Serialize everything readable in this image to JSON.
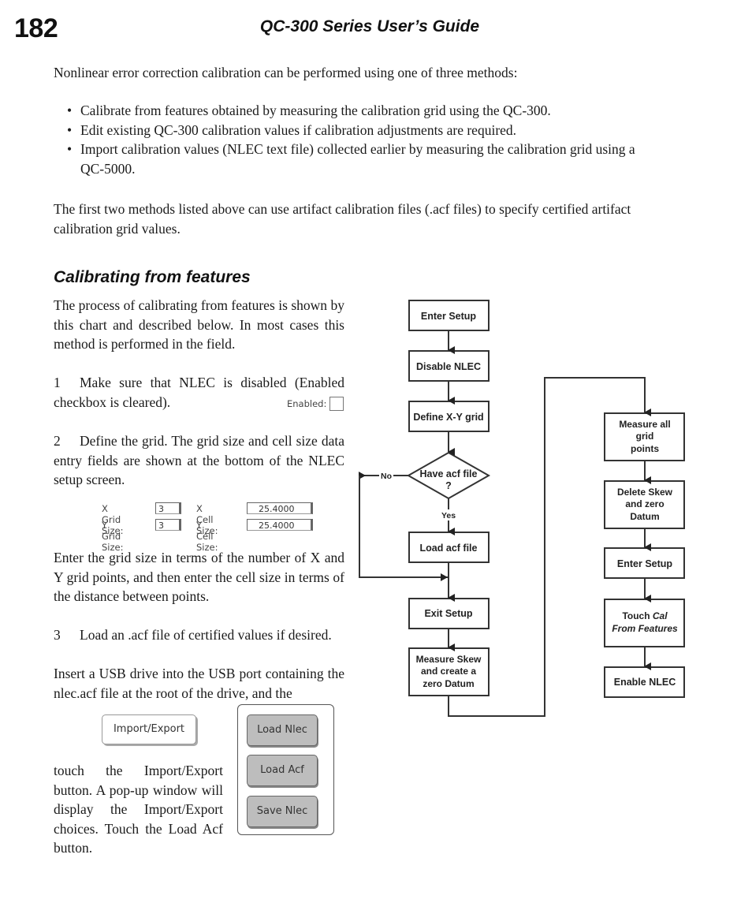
{
  "header": {
    "page_number": "182",
    "title": "QC-300 Series User’s Guide"
  },
  "intro": {
    "lead": "Nonlinear error correction calibration can be performed using one of three methods:",
    "bullets": [
      "Calibrate from features obtained by measuring the calibration grid using the QC-300.",
      "Edit existing QC-300 calibration values if calibration adjustments are required.",
      "Import calibration values (NLEC text file) collected earlier by measuring the calibration grid using a QC-5000."
    ],
    "note": "The first two methods listed above can use artifact calibration files (.acf files) to specify certified artifact calibration grid values."
  },
  "section": {
    "heading": "Calibrating from features",
    "intro": "The process of calibrating from features is shown by this chart and described below. In most cases this method is performed in the field.",
    "steps": [
      {
        "number": "1",
        "text": "Make sure that NLEC is disabled (Enabled checkbox is cleared)."
      },
      {
        "number": "2",
        "text": "Define the grid.  The grid size and cell size data entry fields are shown at the bottom of the NLEC setup screen."
      },
      {
        "number": "3",
        "text": "Load an .acf file of certified values if desired."
      }
    ],
    "grid_note": "Enter the grid size in terms of the number of X and Y grid points, and then enter the cell size in terms of the distance between points.",
    "usb_note": "Insert a USB drive into the USB port containing the nlec.acf file at the root of the drive, and the",
    "touch_note": "touch the Import/Export button.  A pop-up window will display the Import/Export choices.  Touch the Load Acf button."
  },
  "ui_samples": {
    "enabled_label": "Enabled:",
    "enabled_checked": false,
    "x_grid_label": "X Grid Size:",
    "x_grid_value": "3",
    "y_grid_label": "Y Grid Size:",
    "y_grid_value": "3",
    "x_cell_label": "X Cell Size:",
    "x_cell_value": "25.4000",
    "y_cell_label": "Y Cell Size:",
    "y_cell_value": "25.4000",
    "import_export_button": "Import/Export",
    "popup_buttons": [
      "Load Nlec",
      "Load Acf",
      "Save Nlec"
    ]
  },
  "flowchart": {
    "left_column": [
      "Enter Setup",
      "Disable NLEC",
      "Define X-Y grid"
    ],
    "decision": {
      "line1": "Have acf file",
      "line2": "?",
      "no_label": "No",
      "yes_label": "Yes"
    },
    "load_step": "Load acf file",
    "exit_step": "Exit Setup",
    "measure_skew": [
      "Measure Skew",
      "and create a",
      "zero Datum"
    ],
    "right_column": {
      "measure_all": [
        "Measure all",
        "grid",
        "points"
      ],
      "delete_skew": [
        "Delete Skew",
        "and zero",
        "Datum"
      ],
      "enter_setup": "Enter Setup",
      "touch_cal": {
        "prefix": "Touch ",
        "italic1": "Cal",
        "italic2": "From Features"
      },
      "enable_nlec": "Enable NLEC"
    }
  }
}
